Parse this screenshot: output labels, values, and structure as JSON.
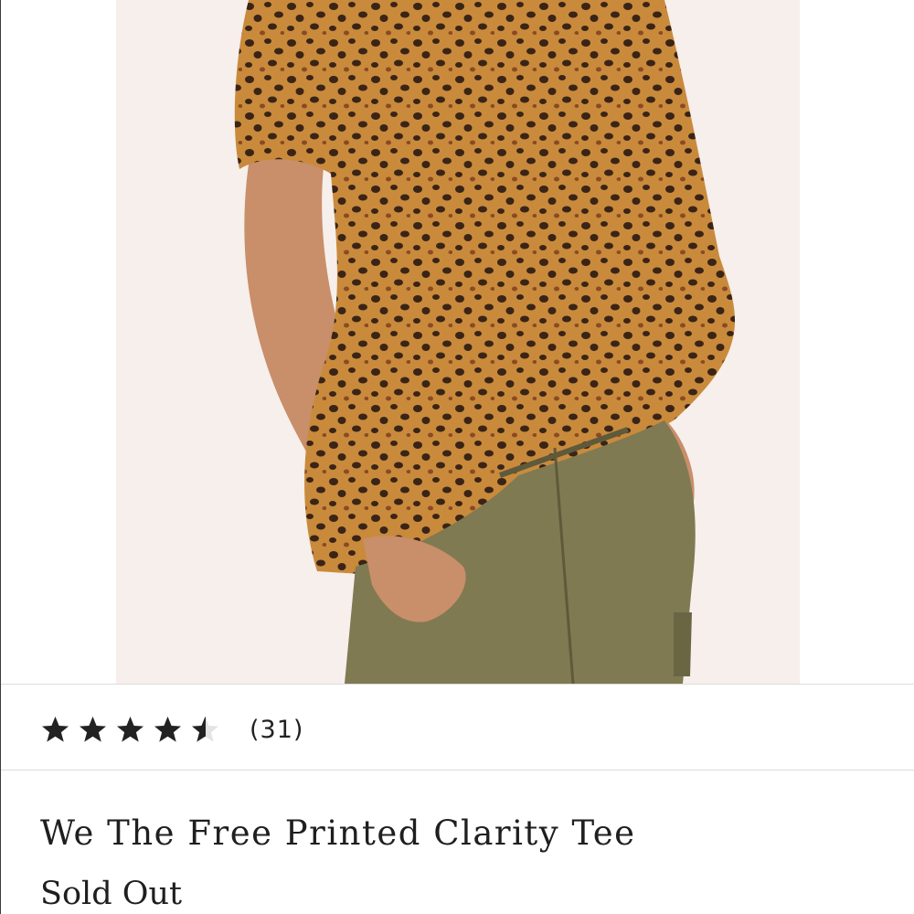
{
  "product": {
    "title": "We The Free Printed Clarity Tee",
    "status": "Sold Out",
    "image_alt": "Model wearing leopard print tee with olive cargo pants"
  },
  "rating": {
    "value": 4.5,
    "max": 5,
    "review_count": "(31)",
    "star_color": "#222222"
  },
  "colors": {
    "photo_background": "#f6efeb",
    "leopard_base": "#c98a3c",
    "leopard_spot": "#3a2416",
    "pants": "#7f7a52",
    "skin": "#c98e6a"
  }
}
